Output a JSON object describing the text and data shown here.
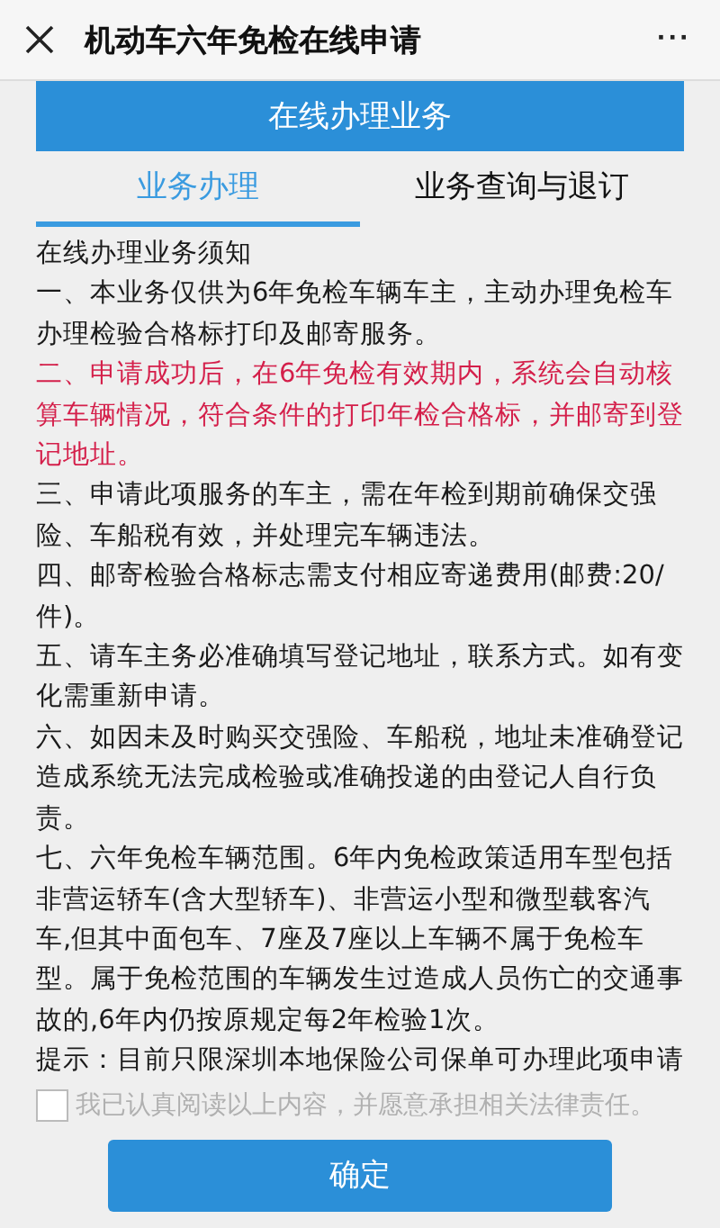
{
  "window": {
    "title": "机动车六年免检在线申请",
    "more": "···"
  },
  "banner": "在线办理业务",
  "tabs": [
    {
      "label": "业务办理",
      "selected": true
    },
    {
      "label": "业务查询与退订",
      "selected": false
    }
  ],
  "notice": {
    "heading": "在线办理业务须知",
    "paragraphs": [
      {
        "kind": "normal",
        "text": "一、本业务仅供为6年免检车辆车主，主动办理免检车办理检验合格标打印及邮寄服务。"
      },
      {
        "kind": "emphasis",
        "text": "二、申请成功后，在6年免检有效期内，系统会自动核算车辆情况，符合条件的打印年检合格标，并邮寄到登记地址。"
      },
      {
        "kind": "normal",
        "text": "三、申请此项服务的车主，需在年检到期前确保交强险、车船税有效，并处理完车辆违法。"
      },
      {
        "kind": "normal",
        "text": "四、邮寄检验合格标志需支付相应寄递费用(邮费:20/件)。"
      },
      {
        "kind": "normal",
        "text": "五、请车主务必准确填写登记地址，联系方式。如有变化需重新申请。"
      },
      {
        "kind": "normal",
        "text": "六、如因未及时购买交强险、车船税，地址未准确登记造成系统无法完成检验或准确投递的由登记人自行负责。"
      },
      {
        "kind": "normal",
        "text": "七、六年免检车辆范围。6年内免检政策适用车型包括非营运轿车(含大型轿车)、非营运小型和微型载客汽车,但其中面包车、7座及7座以上车辆不属于免检车型。属于免检范围的车辆发生过造成人员伤亡的交通事故的,6年内仍按原规定每2年检验1次。"
      },
      {
        "kind": "normal",
        "text": "提示：目前只限深圳本地保险公司保单可办理此项申请"
      }
    ]
  },
  "agreement": {
    "label": "我已认真阅读以上内容，并愿意承担相关法律责任。",
    "checked": false
  },
  "confirm_button": "确定"
}
